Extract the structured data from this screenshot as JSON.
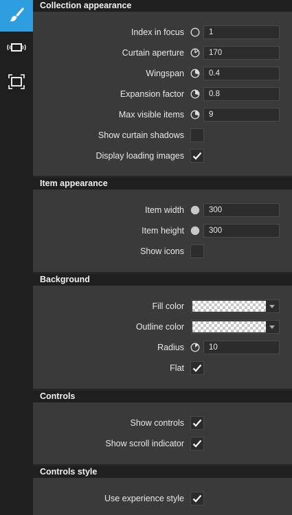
{
  "sidebar": {
    "items": [
      {
        "icon": "brush-icon",
        "active": true
      },
      {
        "icon": "carousel-icon",
        "active": false
      },
      {
        "icon": "frame-icon",
        "active": false
      }
    ]
  },
  "sections": {
    "collection": {
      "title": "Collection appearance",
      "index_in_focus": {
        "label": "Index in focus",
        "value": "1"
      },
      "curtain_aperture": {
        "label": "Curtain aperture",
        "value": "170"
      },
      "wingspan": {
        "label": "Wingspan",
        "value": "0.4"
      },
      "expansion_factor": {
        "label": "Expansion factor",
        "value": "0.8"
      },
      "max_visible_items": {
        "label": "Max visible items",
        "value": "9"
      },
      "show_curtain_shadows": {
        "label": "Show curtain shadows",
        "checked": false
      },
      "display_loading_images": {
        "label": "Display loading images",
        "checked": true
      }
    },
    "item": {
      "title": "Item appearance",
      "item_width": {
        "label": "Item width",
        "value": "300"
      },
      "item_height": {
        "label": "Item height",
        "value": "300"
      },
      "show_icons": {
        "label": "Show icons",
        "checked": false
      }
    },
    "background": {
      "title": "Background",
      "fill_color": {
        "label": "Fill color",
        "value": "transparent"
      },
      "outline_color": {
        "label": "Outline color",
        "value": "transparent"
      },
      "radius": {
        "label": "Radius",
        "value": "10"
      },
      "flat": {
        "label": "Flat",
        "checked": true
      }
    },
    "controls": {
      "title": "Controls",
      "show_controls": {
        "label": "Show controls",
        "checked": true
      },
      "show_scroll_indicator": {
        "label": "Show scroll indicator",
        "checked": true
      }
    },
    "controls_style": {
      "title": "Controls style",
      "use_experience_style": {
        "label": "Use experience style",
        "checked": true
      }
    }
  },
  "colors": {
    "accent": "#2d9ee0",
    "panel": "#3a3a3a",
    "header": "#1f1f1f"
  }
}
